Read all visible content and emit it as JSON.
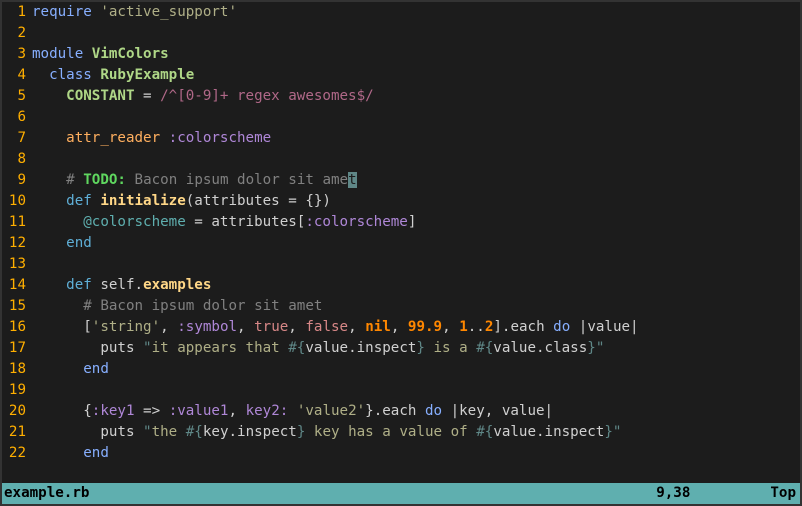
{
  "status": {
    "filename": "example.rb",
    "cursor": "9,38",
    "scroll": "Top"
  },
  "code": [
    {
      "n": 1,
      "tokens": [
        [
          "c-keyword",
          "require "
        ],
        [
          "c-string",
          "'active_support'"
        ]
      ]
    },
    {
      "n": 2,
      "tokens": []
    },
    {
      "n": 3,
      "tokens": [
        [
          "c-keyword",
          "module "
        ],
        [
          "c-const",
          "VimColors"
        ]
      ]
    },
    {
      "n": 4,
      "tokens": [
        [
          "c-fg",
          "  "
        ],
        [
          "c-keyword",
          "class "
        ],
        [
          "c-const",
          "RubyExample"
        ]
      ]
    },
    {
      "n": 5,
      "tokens": [
        [
          "c-fg",
          "    "
        ],
        [
          "c-const",
          "CONSTANT"
        ],
        [
          "c-fg",
          " = "
        ],
        [
          "c-regex",
          "/^[0-9]+ regex awesomes$/"
        ]
      ]
    },
    {
      "n": 6,
      "tokens": []
    },
    {
      "n": 7,
      "tokens": [
        [
          "c-fg",
          "    "
        ],
        [
          "c-attr",
          "attr_reader "
        ],
        [
          "c-symbol",
          ":colorscheme"
        ]
      ]
    },
    {
      "n": 8,
      "tokens": []
    },
    {
      "n": 9,
      "tokens": [
        [
          "c-fg",
          "    "
        ],
        [
          "c-comment",
          "# "
        ],
        [
          "c-todo",
          "TODO:"
        ],
        [
          "c-comment",
          " Bacon ipsum dolor sit ame"
        ],
        [
          "cursor",
          "t"
        ]
      ]
    },
    {
      "n": 10,
      "tokens": [
        [
          "c-fg",
          "    "
        ],
        [
          "c-def",
          "def "
        ],
        [
          "c-ident",
          "initialize"
        ],
        [
          "c-fg",
          "(attributes = {})"
        ]
      ]
    },
    {
      "n": 11,
      "tokens": [
        [
          "c-fg",
          "      "
        ],
        [
          "c-ivar",
          "@colorscheme"
        ],
        [
          "c-fg",
          " = attributes["
        ],
        [
          "c-symbol",
          ":colorscheme"
        ],
        [
          "c-fg",
          "]"
        ]
      ]
    },
    {
      "n": 12,
      "tokens": [
        [
          "c-fg",
          "    "
        ],
        [
          "c-def",
          "end"
        ]
      ]
    },
    {
      "n": 13,
      "tokens": []
    },
    {
      "n": 14,
      "tokens": [
        [
          "c-fg",
          "    "
        ],
        [
          "c-def",
          "def "
        ],
        [
          "c-self",
          "self"
        ],
        [
          "c-fg",
          "."
        ],
        [
          "c-ident",
          "examples"
        ]
      ]
    },
    {
      "n": 15,
      "tokens": [
        [
          "c-fg",
          "      "
        ],
        [
          "c-comment",
          "# Bacon ipsum dolor sit amet"
        ]
      ]
    },
    {
      "n": 16,
      "tokens": [
        [
          "c-fg",
          "      ["
        ],
        [
          "c-string",
          "'string'"
        ],
        [
          "c-fg",
          ", "
        ],
        [
          "c-symbol",
          ":symbol"
        ],
        [
          "c-fg",
          ", "
        ],
        [
          "c-bool",
          "true"
        ],
        [
          "c-fg",
          ", "
        ],
        [
          "c-bool",
          "false"
        ],
        [
          "c-fg",
          ", "
        ],
        [
          "c-nil",
          "nil"
        ],
        [
          "c-fg",
          ", "
        ],
        [
          "c-num",
          "99.9"
        ],
        [
          "c-fg",
          ", "
        ],
        [
          "c-num",
          "1"
        ],
        [
          "c-fg",
          ".."
        ],
        [
          "c-num",
          "2"
        ],
        [
          "c-fg",
          "].each "
        ],
        [
          "c-keyword",
          "do"
        ],
        [
          "c-fg",
          " |value|"
        ]
      ]
    },
    {
      "n": 17,
      "tokens": [
        [
          "c-fg",
          "        puts "
        ],
        [
          "c-delim",
          "\""
        ],
        [
          "c-string",
          "it appears that "
        ],
        [
          "c-interp",
          "#{"
        ],
        [
          "c-fg",
          "value.inspect"
        ],
        [
          "c-interp",
          "}"
        ],
        [
          "c-string",
          " is a "
        ],
        [
          "c-interp",
          "#{"
        ],
        [
          "c-fg",
          "value.class"
        ],
        [
          "c-interp",
          "}"
        ],
        [
          "c-delim",
          "\""
        ]
      ]
    },
    {
      "n": 18,
      "tokens": [
        [
          "c-fg",
          "      "
        ],
        [
          "c-keyword",
          "end"
        ]
      ]
    },
    {
      "n": 19,
      "tokens": []
    },
    {
      "n": 20,
      "tokens": [
        [
          "c-fg",
          "      {"
        ],
        [
          "c-symbol",
          ":key1"
        ],
        [
          "c-fg",
          " => "
        ],
        [
          "c-symbol",
          ":value1"
        ],
        [
          "c-fg",
          ", "
        ],
        [
          "c-symbol",
          "key2: "
        ],
        [
          "c-string",
          "'value2'"
        ],
        [
          "c-fg",
          "}.each "
        ],
        [
          "c-keyword",
          "do"
        ],
        [
          "c-fg",
          " |key, value|"
        ]
      ]
    },
    {
      "n": 21,
      "tokens": [
        [
          "c-fg",
          "        puts "
        ],
        [
          "c-delim",
          "\""
        ],
        [
          "c-string",
          "the "
        ],
        [
          "c-interp",
          "#{"
        ],
        [
          "c-fg",
          "key.inspect"
        ],
        [
          "c-interp",
          "}"
        ],
        [
          "c-string",
          " key has a value of "
        ],
        [
          "c-interp",
          "#{"
        ],
        [
          "c-fg",
          "value.inspect"
        ],
        [
          "c-interp",
          "}"
        ],
        [
          "c-delim",
          "\""
        ]
      ]
    },
    {
      "n": 22,
      "tokens": [
        [
          "c-fg",
          "      "
        ],
        [
          "c-keyword",
          "end"
        ]
      ]
    }
  ]
}
